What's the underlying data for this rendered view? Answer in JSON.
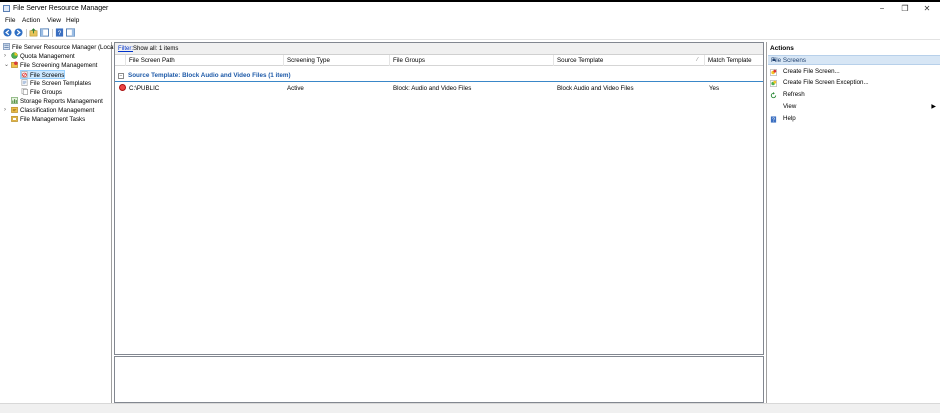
{
  "window": {
    "title": "File Server Resource Manager",
    "minimize": "−",
    "restore": "❐",
    "close": "✕"
  },
  "menu": [
    "File",
    "Action",
    "View",
    "Help"
  ],
  "tree": {
    "root": "File Server Resource Manager (Local)",
    "items": [
      {
        "label": "Quota Management",
        "icon": "quota-icon"
      },
      {
        "label": "File Screening Management",
        "icon": "screening-icon"
      },
      {
        "label": "File Screens",
        "icon": "file-screen-icon"
      },
      {
        "label": "File Screen Templates",
        "icon": "template-icon"
      },
      {
        "label": "File Groups",
        "icon": "file-group-icon"
      },
      {
        "label": "Storage Reports Management",
        "icon": "reports-icon"
      },
      {
        "label": "Classification Management",
        "icon": "classification-icon"
      },
      {
        "label": "File Management Tasks",
        "icon": "tasks-icon"
      }
    ]
  },
  "filter": {
    "link": "Filter:",
    "text": "Show all: 1 items"
  },
  "columns": [
    "File Screen Path",
    "Screening Type",
    "File Groups",
    "Source Template",
    "Match Template"
  ],
  "sort_indicator": "⁄",
  "group": {
    "toggle": "−",
    "label": "Source Template: Block Audio and Video Files (1 item)"
  },
  "rows": [
    {
      "path": "C:\\PUBLIC",
      "type": "Active",
      "groups": "Block: Audio and Video Files",
      "template": "Block Audio and Video Files",
      "match": "Yes"
    }
  ],
  "actions": {
    "title": "Actions",
    "section": "File Screens",
    "section_caret": "▲",
    "items": [
      {
        "label": "Create File Screen...",
        "icon": "create-screen-icon"
      },
      {
        "label": "Create File Screen Exception...",
        "icon": "create-exception-icon"
      },
      {
        "label": "Refresh",
        "icon": "refresh-icon"
      },
      {
        "label": "View",
        "icon": "",
        "submenu": "▶"
      },
      {
        "label": "Help",
        "icon": "help-icon"
      }
    ]
  },
  "colors": {
    "group_text": "#1e5aa8",
    "section_bg": "#d7e6f5",
    "selection": "#cce8ff"
  }
}
